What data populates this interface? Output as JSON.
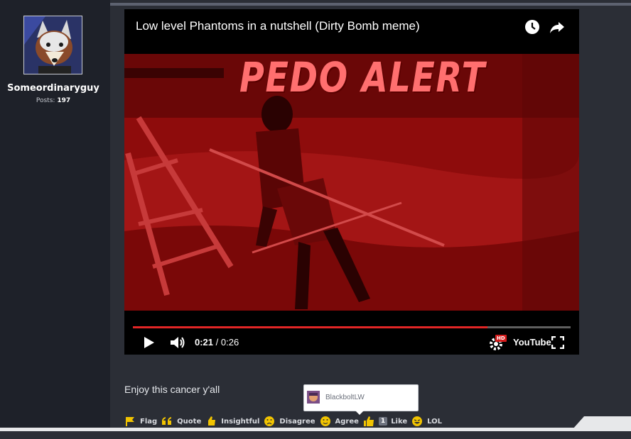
{
  "user": {
    "name": "Someordinaryguy",
    "posts_label": "Posts:",
    "posts_count": "197"
  },
  "video": {
    "title": "Low level Phantoms in a nutshell (Dirty Bomb meme)",
    "overlay_text": "PEDO ALERT",
    "current_time": "0:21",
    "separator": " / ",
    "duration": "0:26",
    "progress_fraction": 0.81,
    "icons": [
      "watch-later-icon",
      "share-icon",
      "play-icon",
      "volume-icon",
      "settings-icon",
      "youtube-logo",
      "fullscreen-icon"
    ],
    "hd_badge": "HD",
    "youtube_logo_text": "YouTube"
  },
  "post": {
    "text": "Enjoy this cancer y'all"
  },
  "tooltip": {
    "name": "BlackboltLW"
  },
  "reactions": [
    {
      "label": "Flag",
      "icon": "flag-icon"
    },
    {
      "label": "Quote",
      "icon": "quote-icon"
    },
    {
      "label": "Insightful",
      "icon": "insightful-icon"
    },
    {
      "label": "Disagree",
      "icon": "disagree-icon"
    },
    {
      "label": "Agree",
      "icon": "agree-icon"
    },
    {
      "label": "Like",
      "icon": "like-icon",
      "count": "1"
    },
    {
      "label": "LOL",
      "icon": "lol-icon"
    }
  ],
  "colors": {
    "accent_red": "#e22626",
    "reaction_yellow": "#f2c400",
    "sidebar_bg": "#1e2129",
    "page_bg": "#2b2e36"
  }
}
